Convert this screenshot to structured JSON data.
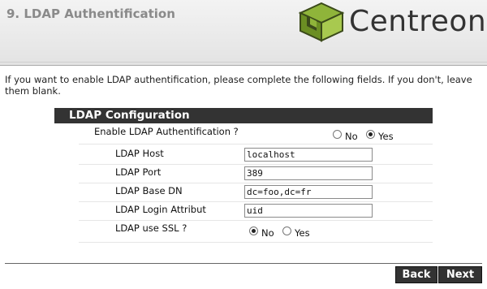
{
  "header": {
    "title": "9. LDAP Authentification",
    "logo_text": "Centreon"
  },
  "intro": "If you want to enable LDAP authentification, please complete the following fields. If you don't, leave them blank.",
  "section": {
    "title": "LDAP Configuration"
  },
  "enable": {
    "label": "Enable LDAP Authentification ?",
    "options": [
      "No",
      "Yes"
    ],
    "selected": "Yes"
  },
  "fields": [
    {
      "label": "LDAP Host",
      "value": "localhost"
    },
    {
      "label": "LDAP Port",
      "value": "389"
    },
    {
      "label": "LDAP Base DN",
      "value": "dc=foo,dc=fr"
    },
    {
      "label": "LDAP Login Attribut",
      "value": "uid"
    }
  ],
  "ssl": {
    "label": "LDAP use SSL ?",
    "options": [
      "No",
      "Yes"
    ],
    "selected": "No"
  },
  "buttons": {
    "back": "Back",
    "next": "Next"
  },
  "colors": {
    "header_bar": "#333333",
    "logo_green": "#8fb43a",
    "logo_dark": "#3b4a1a"
  }
}
